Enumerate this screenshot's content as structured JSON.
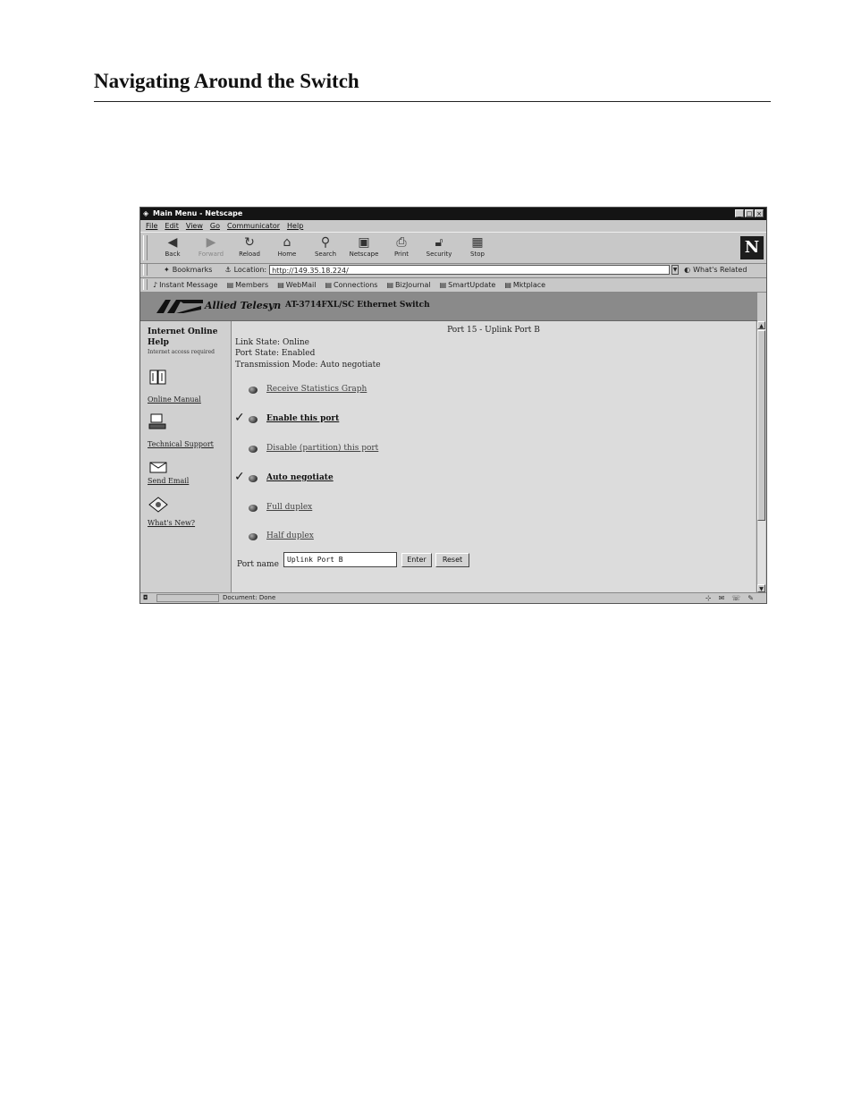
{
  "page": {
    "heading": "Navigating Around the Switch"
  },
  "window": {
    "title": "Main Menu - Netscape",
    "controls": {
      "minimize": "_",
      "maximize": "□",
      "close": "×"
    }
  },
  "menu": [
    "File",
    "Edit",
    "View",
    "Go",
    "Communicator",
    "Help"
  ],
  "toolbar": {
    "back": "Back",
    "forward": "Forward",
    "reload": "Reload",
    "home": "Home",
    "search": "Search",
    "netscape": "Netscape",
    "print": "Print",
    "security": "Security",
    "stop": "Stop",
    "logo": "N"
  },
  "location": {
    "bookmarks": "Bookmarks",
    "label": "Location:",
    "url": "http://149.35.18.224/",
    "related": "What's Related"
  },
  "personal_toolbar": [
    "Instant Message",
    "Members",
    "WebMail",
    "Connections",
    "BizJournal",
    "SmartUpdate",
    "Mktplace"
  ],
  "banner": {
    "brand": "Allied Telesyn",
    "product": "AT-3714FXL/SC Ethernet Switch"
  },
  "help": {
    "heading": "Internet Online Help",
    "note": "Internet access required",
    "links": {
      "manual": "Online Manual",
      "support": "Technical Support",
      "email": "Send Email",
      "whats_new": "What's New?"
    }
  },
  "port": {
    "title": "Port 15 - Uplink Port B",
    "link_state": "Link State: Online",
    "port_state": "Port State: Enabled",
    "transmission_mode": "Transmission Mode: Auto negotiate",
    "actions": {
      "receive_stats": "Receive Statistics Graph",
      "enable": "Enable this port",
      "disable": "Disable (partition) this port",
      "auto": "Auto negotiate",
      "full": "Full duplex",
      "half": "Half duplex"
    },
    "check_mark": "✓",
    "name_label": "Port name",
    "name_value": "Uplink Port B",
    "enter_label": "Enter",
    "reset_label": "Reset"
  },
  "status": {
    "text": "Document: Done"
  }
}
